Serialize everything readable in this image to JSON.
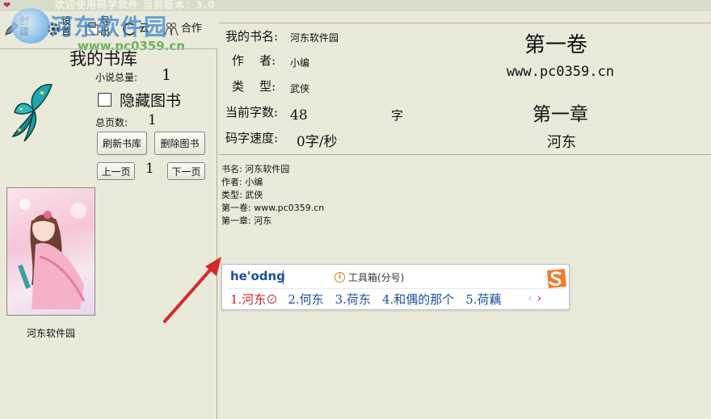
{
  "window": {
    "title": "欢迎使用码字软件  当前版本：3.0"
  },
  "toolbar": {
    "create_label": "创建",
    "settings_label": "设置",
    "export_label": "导出",
    "cloud_label": "云",
    "cooperate_label": "合作"
  },
  "watermark": {
    "text": "河东软件园",
    "url": "www.pc0359.cn"
  },
  "library": {
    "title": "我的书库",
    "total_novels_label": "小说总量:",
    "total_novels_value": "1",
    "hide_books_label": "隐藏图书",
    "total_pages_label": "总页数:",
    "total_pages_value": "1",
    "refresh_button": "刷新书库",
    "delete_button": "删除图书",
    "prev_button": "上一页",
    "current_page": "1",
    "next_button": "下一页",
    "book_name": "河东软件园"
  },
  "info": {
    "book_name_label": "我的书名:",
    "book_name_value": "河东软件园",
    "author_label": "作    者:",
    "author_value": "小编",
    "genre_label": "类    型:",
    "genre_value": "武侠",
    "word_count_label": "当前字数:",
    "word_count_value": "48",
    "word_unit": "字",
    "speed_label": "码字速度:",
    "speed_value": "0字/秒",
    "volume_title": "第一卷",
    "volume_name": "www.pc0359.cn",
    "chapter_title": "第一章",
    "chapter_name": "河东"
  },
  "editor": {
    "lines": [
      "书名: 河东软件园",
      "作者: 小编",
      "类型: 武侠",
      "第一卷: www.pc0359.cn",
      "第一章: 河东"
    ]
  },
  "ime": {
    "input": "he'odng",
    "toolbox_label": "工具箱(分号)",
    "candidates": [
      "1.河东",
      "2.何东",
      "3.荷东",
      "4.和偶的那个",
      "5.荷藕"
    ],
    "prev": "‹",
    "next": "›"
  },
  "colors": {
    "background": "#eaeadb",
    "ime_blue": "#1f4f9d",
    "ime_red": "#d3232a",
    "arrow_red": "#d42a2a"
  }
}
